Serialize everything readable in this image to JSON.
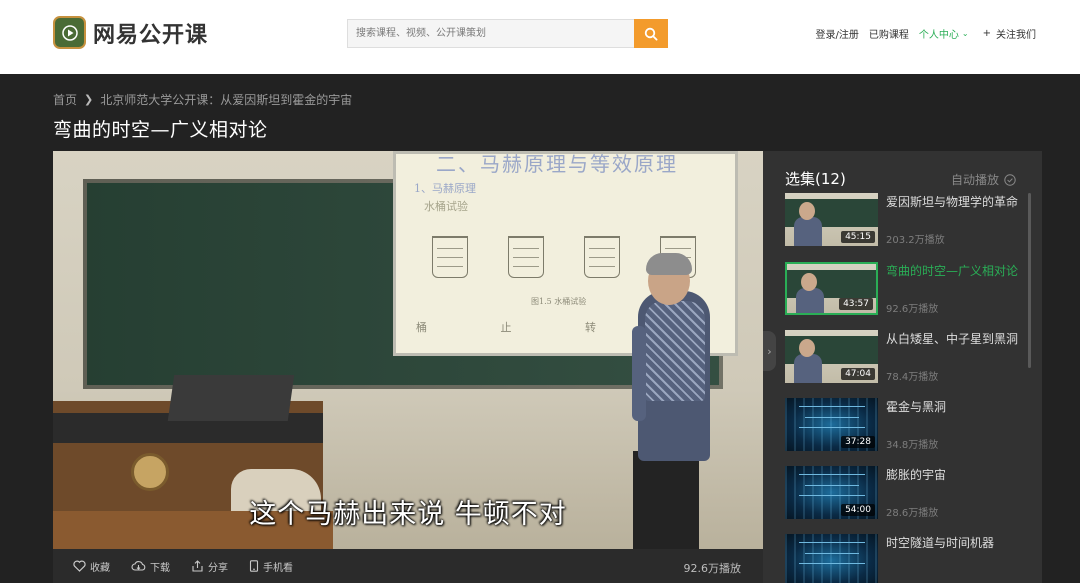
{
  "header": {
    "logo_text": "网易公开课",
    "search_placeholder": "搜索课程、视频、公开课策划",
    "nav": {
      "login": "登录/注册",
      "purchased": "已购课程",
      "personal": "个人中心",
      "follow": "关注我们"
    }
  },
  "breadcrumb": {
    "home": "首页",
    "course": "北京师范大学公开课：从爱因斯坦到霍金的宇宙"
  },
  "page_title": "弯曲的时空—广义相对论",
  "video": {
    "subtitle": "这个马赫出来说 牛顿不对",
    "slide_title": "二、马赫原理与等效原理",
    "slide_sub": "1、马赫原理",
    "slide_sub2": "水桶试验",
    "slide_foot": "桶 止 转 转",
    "slide_caption": "图1.5 水桶试验"
  },
  "toolbar": {
    "favorite": "收藏",
    "download": "下载",
    "share": "分享",
    "mobile": "手机看",
    "play_count": "92.6万播放"
  },
  "playlist": {
    "header": "选集(12)",
    "autoplay": "自动播放",
    "items": [
      {
        "title": "爱因斯坦与物理学的革命",
        "duration": "45:15",
        "plays": "203.2万播放",
        "active": false,
        "thumb": "lecture"
      },
      {
        "title": "弯曲的时空—广义相对论",
        "duration": "43:57",
        "plays": "92.6万播放",
        "active": true,
        "thumb": "lecture"
      },
      {
        "title": "从白矮星、中子星到黑洞",
        "duration": "47:04",
        "plays": "78.4万播放",
        "active": false,
        "thumb": "lecture"
      },
      {
        "title": "霍金与黑洞",
        "duration": "37:28",
        "plays": "34.8万播放",
        "active": false,
        "thumb": "blue"
      },
      {
        "title": "膨胀的宇宙",
        "duration": "54:00",
        "plays": "28.6万播放",
        "active": false,
        "thumb": "blue"
      },
      {
        "title": "时空隧道与时间机器",
        "duration": "",
        "plays": "",
        "active": false,
        "thumb": "blue"
      }
    ]
  },
  "colors": {
    "accent_green": "#2aae56",
    "search_orange": "#f39b2c",
    "page_bg": "#222222"
  }
}
